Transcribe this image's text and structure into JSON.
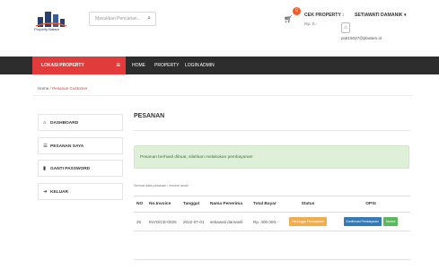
{
  "header": {
    "logo_text": "Property Batam",
    "search_placeholder": "Masukkan Pencarian...",
    "cart_count": "0",
    "cek_label": "CEK PROPERTY :",
    "cek_value": "Rp. 0,-",
    "user_name": "SETIAWATI DAMANIK ▾",
    "user_email": "piat15027@pbatam.id"
  },
  "nav": {
    "lokasi_label": "LOKASI PROPERTY",
    "links": [
      "HOME",
      "PROPERTY",
      "LOGIN ADMIN"
    ]
  },
  "breadcrumb": {
    "home": "Home",
    "separator": " / ",
    "current": "Pesanan Customer"
  },
  "sidebar": {
    "items": [
      {
        "label": "DASHBOARD",
        "icon": "home-icon"
      },
      {
        "label": "PESANAN SAYA",
        "icon": "list-icon"
      },
      {
        "label": "GANTI PASSWORD",
        "icon": "lock-icon"
      },
      {
        "label": "KELUAR",
        "icon": "logout-icon"
      }
    ]
  },
  "main": {
    "title": "PESANAN",
    "alert": "Pesanan berhasil dibuat, silahkan melakukan pembayaran!",
    "filter_text": "Semua data pesanan / invoice anda",
    "table": {
      "headers": [
        "NO",
        "No.Invoice",
        "Tanggal",
        "Nama Penerima",
        "Total Bayar",
        "Status",
        "OPSI"
      ],
      "rows": [
        {
          "no": "25",
          "invoice": "INVOICE-0025",
          "tanggal": "2022-07-01",
          "nama": "setiawati damanik",
          "total": "Rp. 400.000,-",
          "status": "Menunggu Pembayaran",
          "btn_konfirmasi": "Konfirmasi Pembayaran",
          "btn_invoice": "Invoice"
        }
      ]
    }
  },
  "colors": {
    "accent": "#e13b3b",
    "navbar": "#2d2d2d",
    "alert_bg": "#dff0d8",
    "status_warning": "#f0ad4e",
    "btn_primary": "#337ab7",
    "btn_success": "#5cb85c"
  }
}
